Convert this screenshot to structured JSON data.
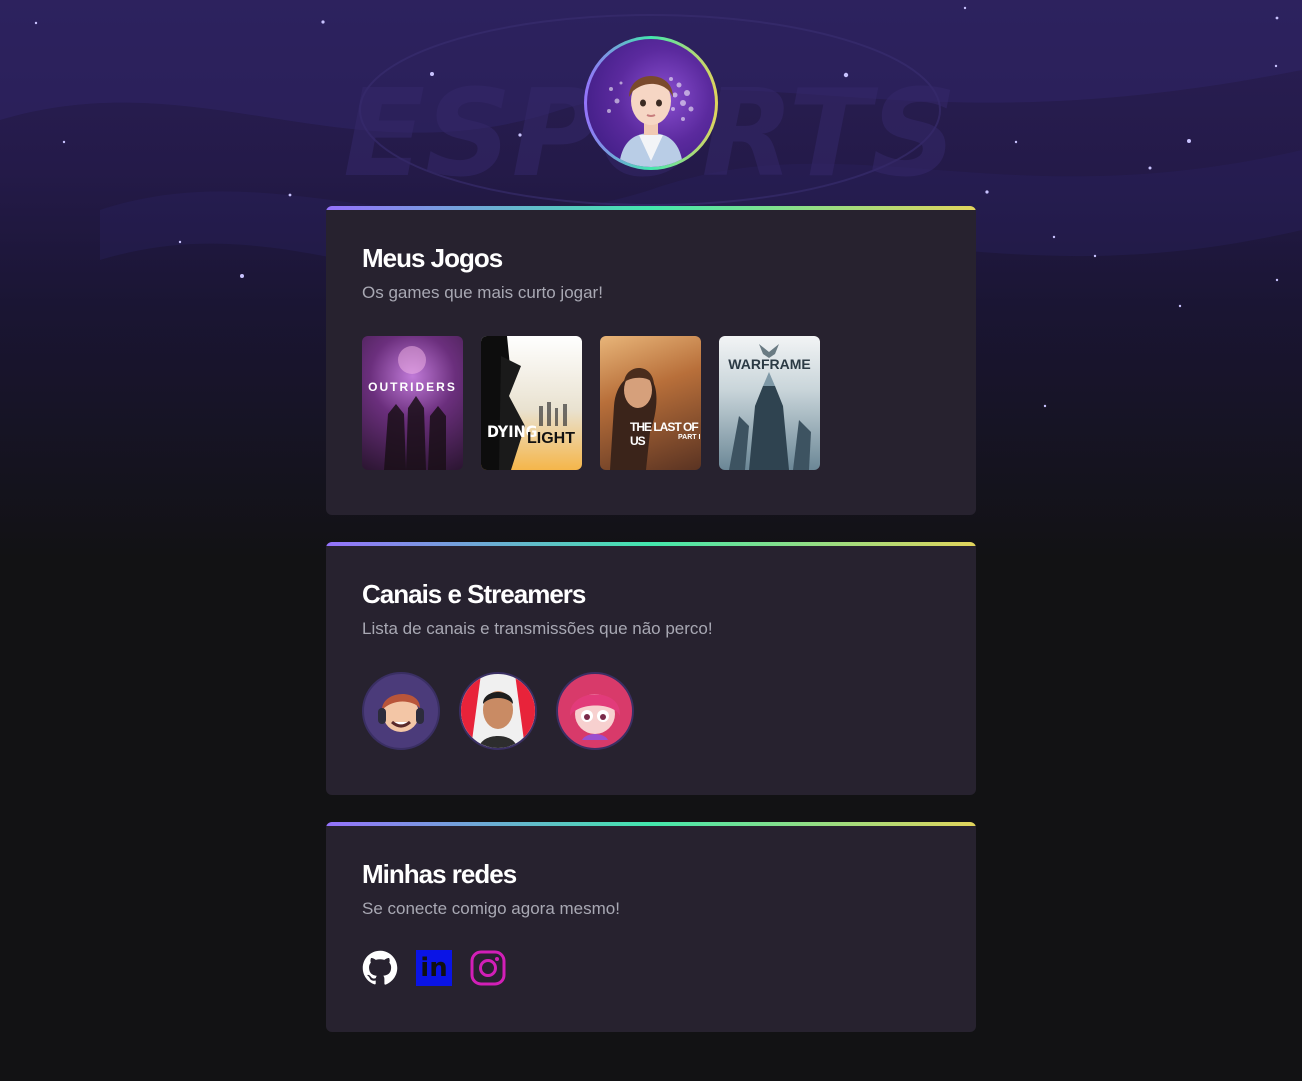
{
  "background": {
    "watermark": "ESPORTS"
  },
  "profile": {
    "avatar_icon": "profile-avatar-image"
  },
  "sections": {
    "games": {
      "title": "Meus Jogos",
      "subtitle": "Os games que mais curto jogar!",
      "items": [
        {
          "label": "OUTRIDERS",
          "icon": "outriders-cover"
        },
        {
          "label_a": "DYING",
          "label_b": "LIGHT",
          "icon": "dying-light-cover"
        },
        {
          "label_a": "THE LAST OF US",
          "label_b": "PART I",
          "icon": "the-last-of-us-cover"
        },
        {
          "label": "WARFRAME",
          "icon": "warframe-cover"
        }
      ]
    },
    "streamers": {
      "title": "Canais e Streamers",
      "subtitle": "Lista de canais e transmissões que não perco!",
      "items": [
        {
          "icon": "streamer-avatar-1"
        },
        {
          "icon": "streamer-avatar-2"
        },
        {
          "icon": "streamer-avatar-3"
        }
      ]
    },
    "socials": {
      "title": "Minhas redes",
      "subtitle": "Se conecte comigo agora mesmo!",
      "items": [
        {
          "icon": "github-icon",
          "color": "#ffffff"
        },
        {
          "icon": "linkedin-icon",
          "label": "in",
          "color": "#0a14e6"
        },
        {
          "icon": "instagram-icon",
          "color": "#d21fb7"
        }
      ]
    }
  },
  "colors": {
    "page_bg": "#121214",
    "card_bg": "#27222f",
    "gradient": [
      "#9572fc",
      "#43e7ad",
      "#e2d45c"
    ],
    "title": "#ffffff",
    "subtitle": "#a8a8b3"
  }
}
